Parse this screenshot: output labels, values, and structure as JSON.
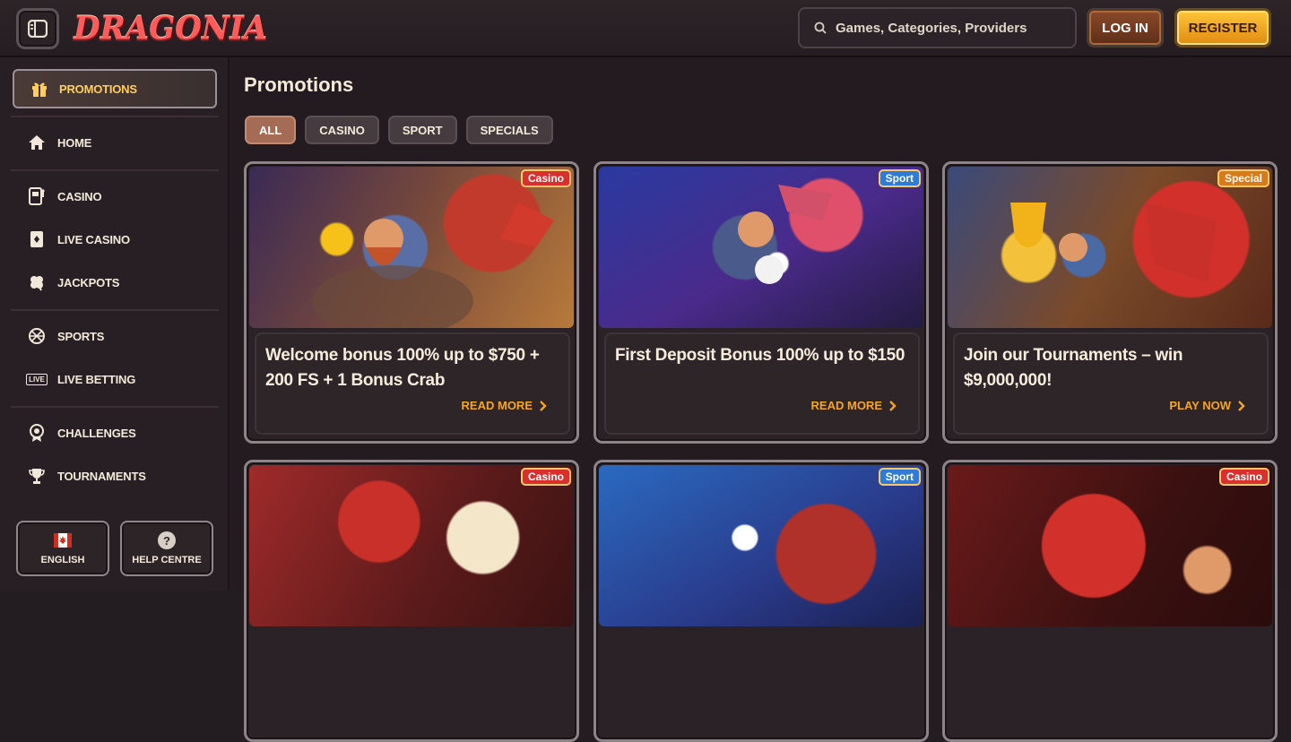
{
  "header": {
    "logo_text": "DRAGONIA",
    "search_placeholder": "Games, Categories, Providers",
    "login_label": "LOG IN",
    "register_label": "REGISTER"
  },
  "sidebar": {
    "promotions": "PROMOTIONS",
    "items": [
      {
        "label": "HOME",
        "icon": "home-icon"
      },
      {
        "label": "CASINO",
        "icon": "slot-machine-icon"
      },
      {
        "label": "LIVE CASINO",
        "icon": "card-icon"
      },
      {
        "label": "JACKPOTS",
        "icon": "clover-icon"
      },
      {
        "label": "SPORTS",
        "icon": "basketball-icon"
      },
      {
        "label": "LIVE BETTING",
        "icon": "live-icon"
      },
      {
        "label": "CHALLENGES",
        "icon": "medal-icon"
      },
      {
        "label": "TOURNAMENTS",
        "icon": "trophy-icon"
      }
    ],
    "language_label": "ENGLISH",
    "help_label": "HELP CENTRE",
    "help_symbol": "?",
    "live_badge": "LIVE"
  },
  "main": {
    "title": "Promotions",
    "filters": [
      "ALL",
      "CASINO",
      "SPORT",
      "SPECIALS"
    ],
    "active_filter": "ALL",
    "cards": [
      {
        "badge": "Casino",
        "title": "Welcome bonus 100% up to $750 + 200 FS + 1 Bonus Crab",
        "cta": "READ MORE"
      },
      {
        "badge": "Sport",
        "title": "First Deposit Bonus 100% up to $150",
        "cta": "READ MORE"
      },
      {
        "badge": "Special",
        "title": "Join our Tournaments – win $9,000,000!",
        "cta": "PLAY NOW"
      },
      {
        "badge": "Casino"
      },
      {
        "badge": "Sport"
      },
      {
        "badge": "Casino"
      }
    ]
  },
  "colors": {
    "accent_gold": "#f5a623",
    "badge_casino": "#d9302e",
    "badge_sport": "#2f7bd6",
    "badge_special": "#d87a1a"
  }
}
